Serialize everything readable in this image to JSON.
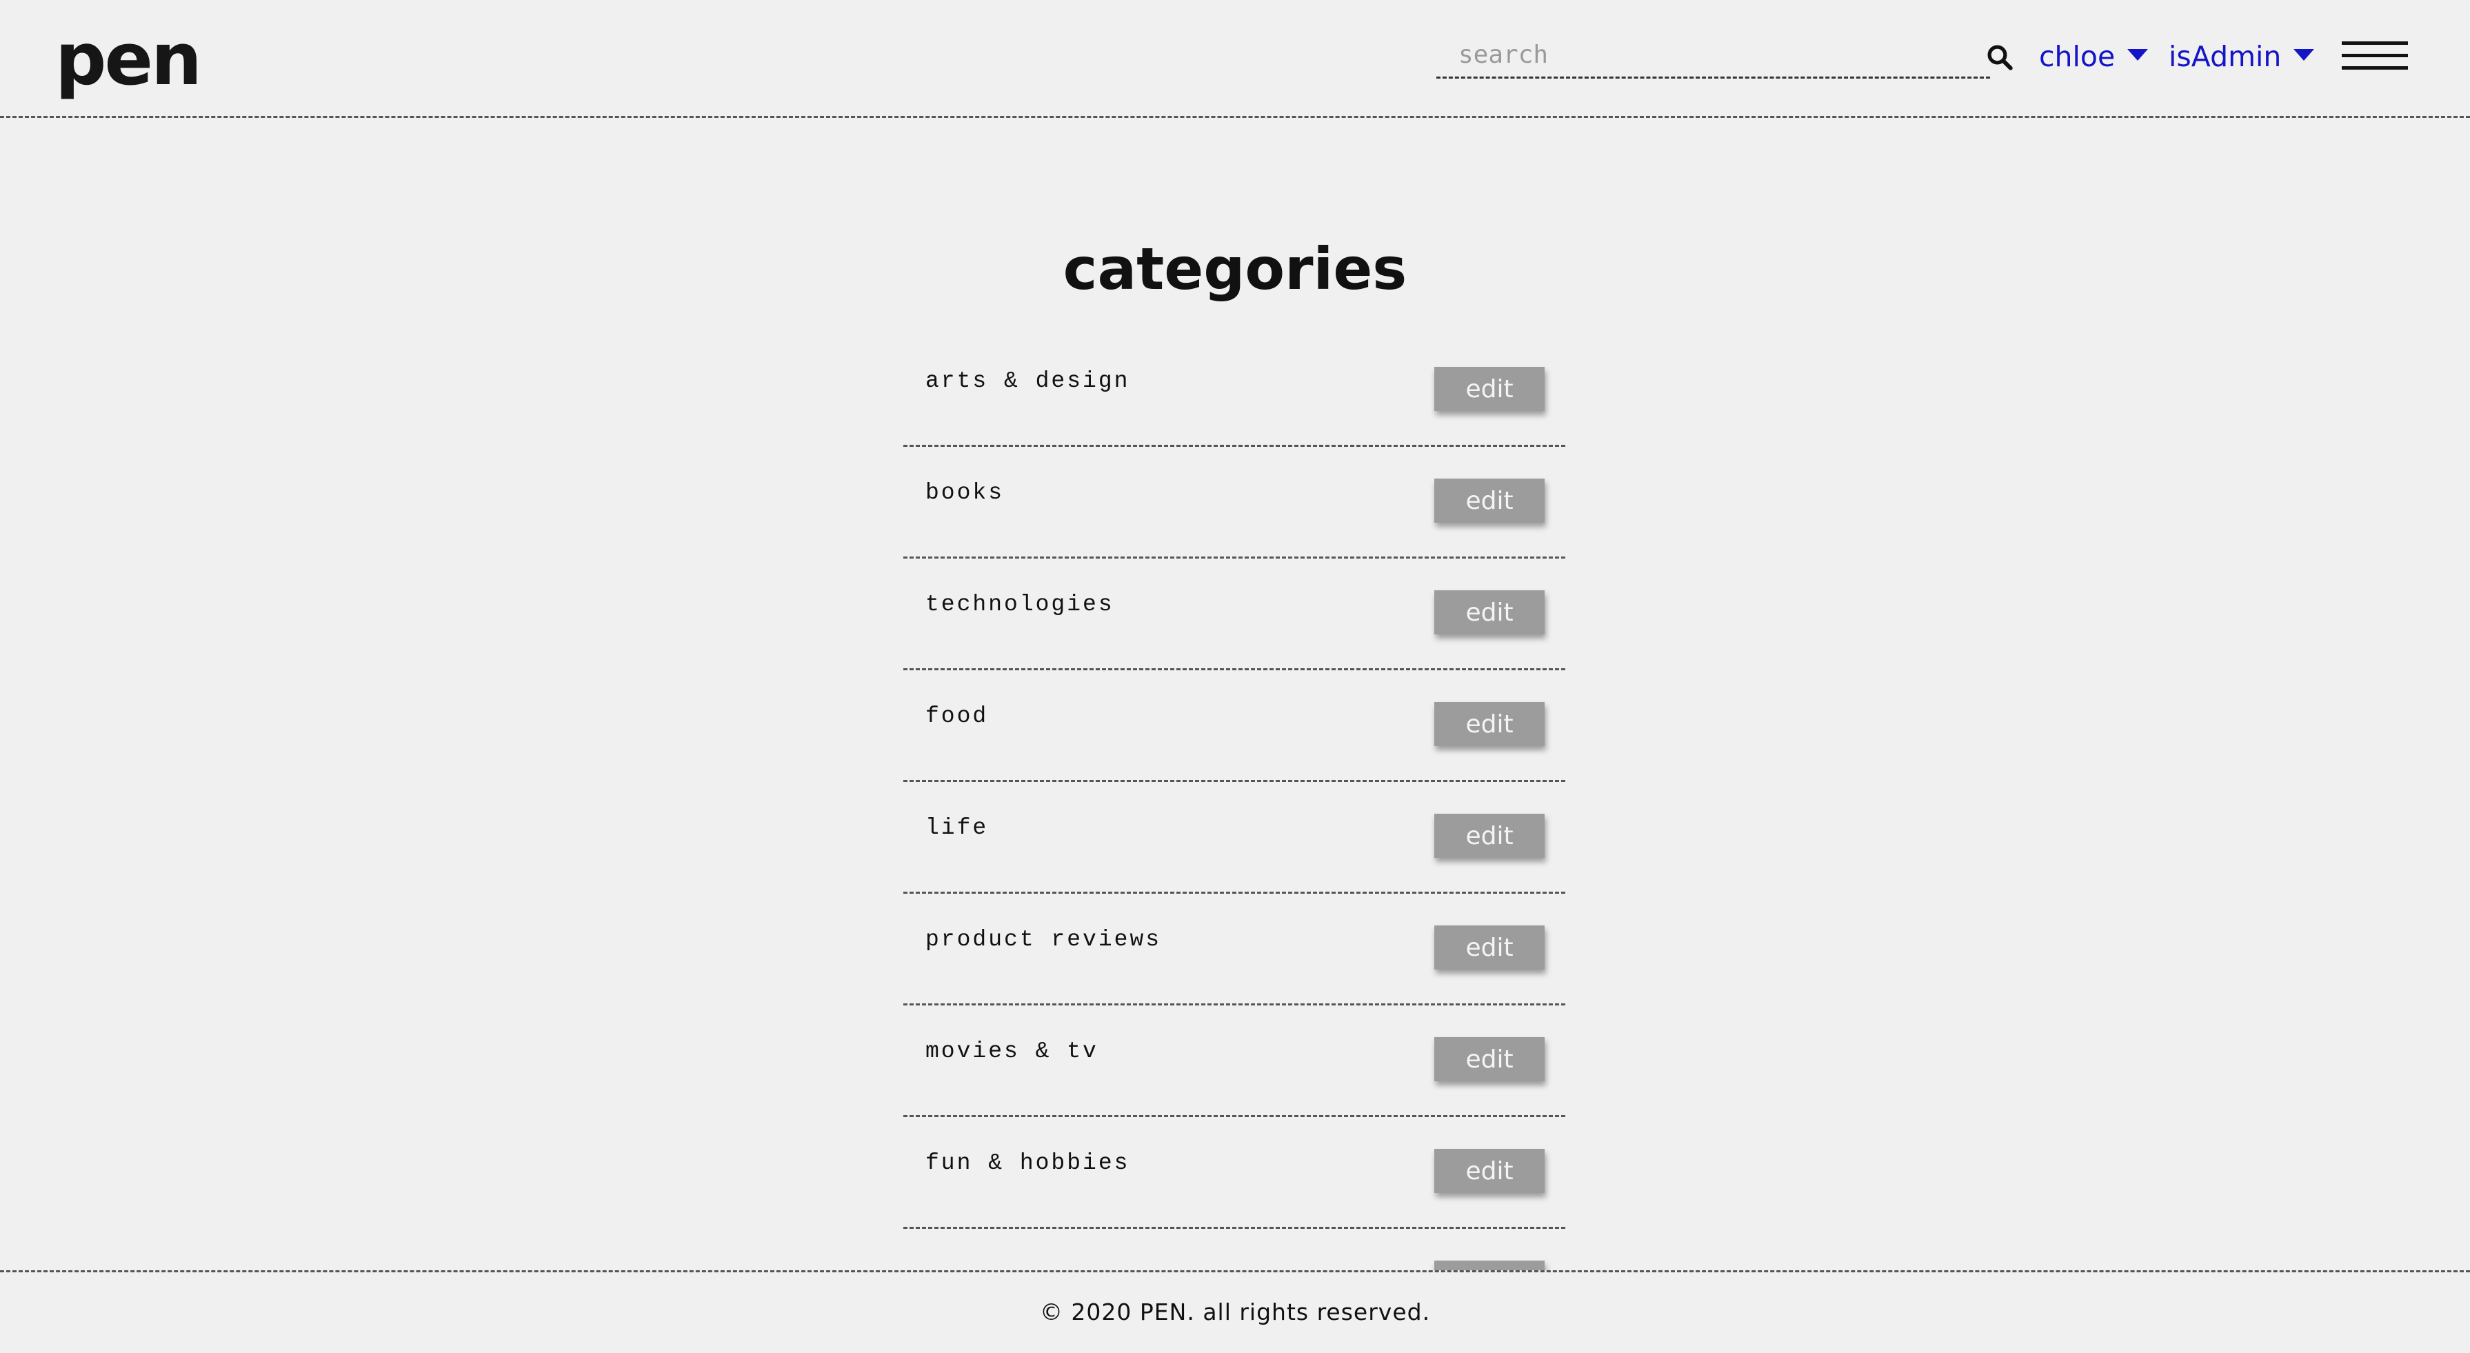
{
  "header": {
    "logo": "pen",
    "search": {
      "placeholder": "search",
      "value": ""
    },
    "user_menu": {
      "label": "chloe"
    },
    "role_menu": {
      "label": "isAdmin"
    },
    "accent_color": "#1414c8",
    "icons": [
      "search-icon",
      "caret-down-icon",
      "hamburger-menu-icon"
    ]
  },
  "main": {
    "title": "categories",
    "categories": [
      {
        "name": "arts & design",
        "action": "edit"
      },
      {
        "name": "books",
        "action": "edit"
      },
      {
        "name": "technologies",
        "action": "edit"
      },
      {
        "name": "food",
        "action": "edit"
      },
      {
        "name": "life",
        "action": "edit"
      },
      {
        "name": "product reviews",
        "action": "edit"
      },
      {
        "name": "movies & tv",
        "action": "edit"
      },
      {
        "name": "fun & hobbies",
        "action": "edit"
      },
      {
        "name": "",
        "action": ""
      }
    ]
  },
  "footer": {
    "text": "© 2020 PEN. all rights reserved."
  }
}
